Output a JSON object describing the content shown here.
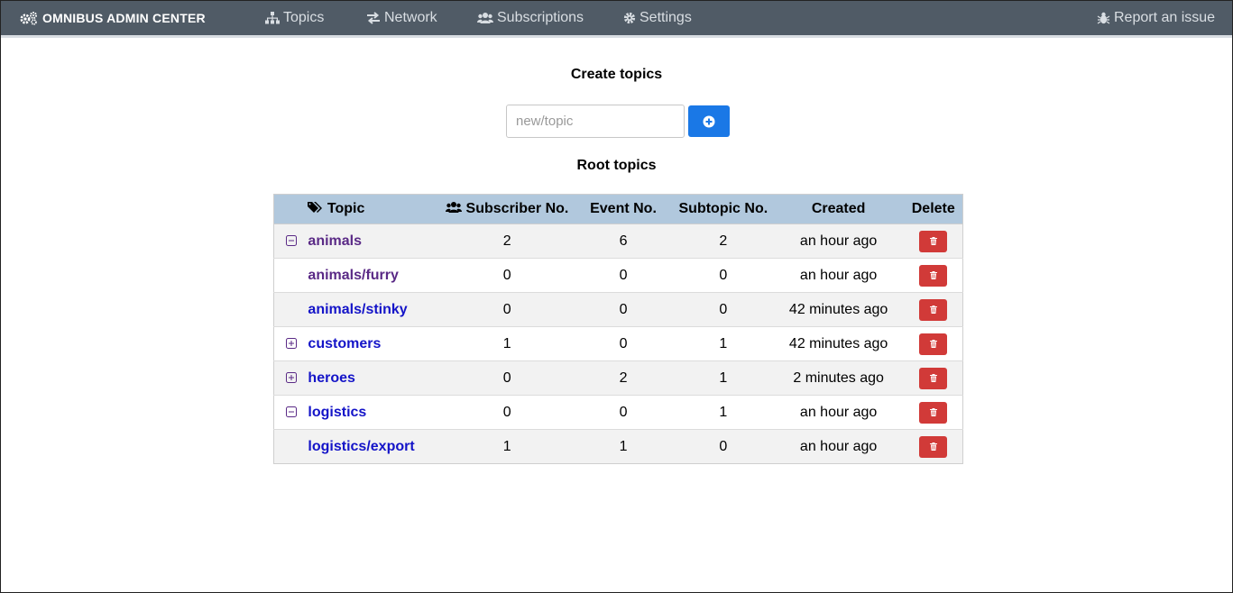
{
  "navbar": {
    "brand": "OMNIBUS ADMIN CENTER",
    "items": [
      {
        "label": "Topics",
        "icon": "sitemap-icon"
      },
      {
        "label": "Network",
        "icon": "exchange-icon"
      },
      {
        "label": "Subscriptions",
        "icon": "users-icon"
      },
      {
        "label": "Settings",
        "icon": "gear-icon"
      }
    ],
    "report": {
      "label": "Report an issue",
      "icon": "bug-icon"
    }
  },
  "create": {
    "title": "Create topics",
    "placeholder": "new/topic",
    "button_icon": "plus-circle-icon"
  },
  "root_title": "Root topics",
  "table": {
    "headers": {
      "topic": "Topic",
      "subscribers": "Subscriber No.",
      "events": "Event No.",
      "subtopics": "Subtopic No.",
      "created": "Created",
      "delete": "Delete"
    },
    "rows": [
      {
        "toggle": "minus",
        "name": "animals",
        "subscribers": "2",
        "events": "6",
        "subtopics": "2",
        "created": "an hour ago",
        "visited": true
      },
      {
        "toggle": "",
        "name": "animals/furry",
        "subscribers": "0",
        "events": "0",
        "subtopics": "0",
        "created": "an hour ago",
        "visited": true
      },
      {
        "toggle": "",
        "name": "animals/stinky",
        "subscribers": "0",
        "events": "0",
        "subtopics": "0",
        "created": "42 minutes ago",
        "visited": false
      },
      {
        "toggle": "plus",
        "name": "customers",
        "subscribers": "1",
        "events": "0",
        "subtopics": "1",
        "created": "42 minutes ago",
        "visited": false
      },
      {
        "toggle": "plus",
        "name": "heroes",
        "subscribers": "0",
        "events": "2",
        "subtopics": "1",
        "created": "2 minutes ago",
        "visited": false
      },
      {
        "toggle": "minus",
        "name": "logistics",
        "subscribers": "0",
        "events": "0",
        "subtopics": "1",
        "created": "an hour ago",
        "visited": false
      },
      {
        "toggle": "",
        "name": "logistics/export",
        "subscribers": "1",
        "events": "1",
        "subtopics": "0",
        "created": "an hour ago",
        "visited": false
      }
    ]
  },
  "colors": {
    "navbar": "#505b66",
    "primary": "#1a78e6",
    "danger": "#d13a38",
    "table_header": "#b1c8dd",
    "link": "#1414c8",
    "link_visited": "#5a2a86"
  }
}
